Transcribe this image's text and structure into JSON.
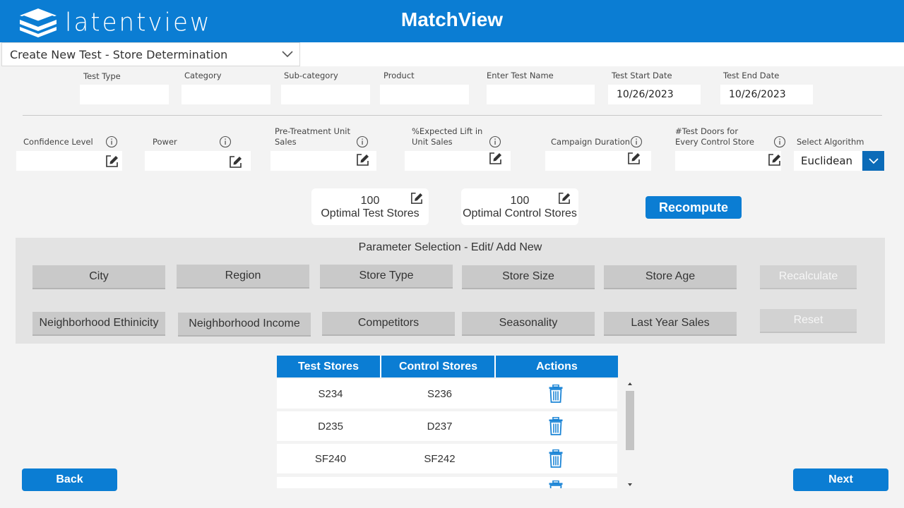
{
  "header": {
    "logo_text": "latentview",
    "app_title": "MatchView"
  },
  "view_select": {
    "value": "Create New Test - Store Determination"
  },
  "test_fields": {
    "test_type": "Test Type",
    "category": "Category",
    "sub_category": "Sub-category",
    "product": "Product",
    "test_name": "Enter Test Name",
    "start_date_label": "Test Start Date",
    "start_date_value": "10/26/2023",
    "end_date_label": "Test End Date",
    "end_date_value": "10/26/2023"
  },
  "params": {
    "confidence": "Confidence Level",
    "power": "Power",
    "pre_treatment_1": "Pre-Treatment Unit",
    "pre_treatment_2": "Sales",
    "lift_1": "%Expected Lift in",
    "lift_2": "Unit Sales",
    "duration": "Campaign Duration",
    "doors_1": "#Test Doors for",
    "doors_2": "Every Control Store",
    "algo_label": "Select Algorithm",
    "algo_value": "Euclidean"
  },
  "optimal": {
    "test_value": "100",
    "test_label": "Optimal Test Stores",
    "control_value": "100",
    "control_label": "Optimal Control Stores",
    "recompute": "Recompute"
  },
  "parameter_selection": {
    "title": "Parameter Selection - Edit/  Add New",
    "buttons_row1": [
      "City",
      "Region",
      "Store Type",
      "Store Size",
      "Store Age"
    ],
    "buttons_row2": [
      "Neighborhood Ethinicity",
      "Neighborhood Income",
      "Competitors",
      "Seasonality",
      "Last Year Sales"
    ],
    "recalculate": "Recalculate",
    "reset": "Reset"
  },
  "table": {
    "headers": [
      "Test Stores",
      "Control Stores",
      "Actions"
    ],
    "rows": [
      [
        "S234",
        "S236"
      ],
      [
        "D235",
        "D237"
      ],
      [
        "SF240",
        "SF242"
      ]
    ]
  },
  "nav": {
    "back": "Back",
    "next": "Next"
  },
  "colors": {
    "primary": "#0b7dd3",
    "panel": "#e3e3e3",
    "param_button": "#c9c9c9"
  }
}
